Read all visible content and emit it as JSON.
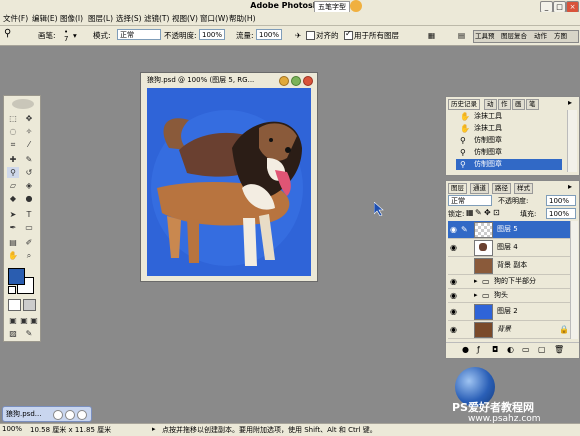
{
  "app": {
    "title": "Adobe Photoshop",
    "ime_label": "五笔字型"
  },
  "menu": [
    "文件(F)",
    "编辑(E)",
    "图像(I)",
    "图层(L)",
    "选择(S)",
    "滤镜(T)",
    "视图(V)",
    "窗口(W)",
    "帮助(H)"
  ],
  "options": {
    "brush_label": "画笔:",
    "brush_size": "7",
    "mode_label": "模式:",
    "mode_value": "正常",
    "opacity_label": "不透明度:",
    "opacity_value": "100%",
    "flow_label": "流量:",
    "flow_value": "100%",
    "aligned_label": "对齐的",
    "all_layers_label": "用于所有图层"
  },
  "palette_well": {
    "tabs": [
      "工具预",
      "图层复合",
      "动作",
      "方图"
    ]
  },
  "document": {
    "title": "狼狗.psd @ 100% (图层 5, RG..."
  },
  "history": {
    "tabs": [
      "历史记录",
      "动",
      "作",
      "画",
      "笔"
    ],
    "items": [
      {
        "label": "涂抹工具",
        "selected": false
      },
      {
        "label": "涂抹工具",
        "selected": false
      },
      {
        "label": "仿制图章",
        "selected": false
      },
      {
        "label": "仿制图章",
        "selected": false
      },
      {
        "label": "仿制图章",
        "selected": true
      }
    ]
  },
  "layers_panel": {
    "tabs": [
      "图层",
      "通道",
      "路径",
      "样式"
    ],
    "blend_mode": "正常",
    "opacity_label": "不透明度:",
    "opacity_value": "100%",
    "lock_label": "锁定:",
    "fill_label": "填充:",
    "fill_value": "100%",
    "layers": [
      {
        "name": "图层 5",
        "selected": true,
        "visible": true,
        "kind": "layer"
      },
      {
        "name": "图层 4",
        "selected": false,
        "visible": true,
        "kind": "layer"
      },
      {
        "name": "背景 副本",
        "selected": false,
        "visible": false,
        "kind": "layer"
      },
      {
        "name": "狗的下半部分",
        "selected": false,
        "visible": true,
        "kind": "group"
      },
      {
        "name": "狗头",
        "selected": false,
        "visible": true,
        "kind": "group"
      },
      {
        "name": "图层 2",
        "selected": false,
        "visible": true,
        "kind": "layer"
      },
      {
        "name": "背景",
        "selected": false,
        "visible": true,
        "kind": "layer"
      }
    ]
  },
  "taskbar": {
    "item_label": "狼狗.psd..."
  },
  "status": {
    "zoom": "100%",
    "doc_size": "10.58 厘米 x 11.85 厘米",
    "hint": "点按并拖移以创建副本。要用附加选项，使用 Shift、Alt 和 Ctrl 键。"
  },
  "watermark": {
    "line1": "PS爱好者教程网",
    "line2": "www.psahz.com"
  },
  "colors": {
    "workspace_bg": "#8a8a8a",
    "canvas_blue": "#2f64d8",
    "selection_blue": "#3169c6",
    "foreground_color": "#2a5db0",
    "background_color": "#ffffff"
  }
}
